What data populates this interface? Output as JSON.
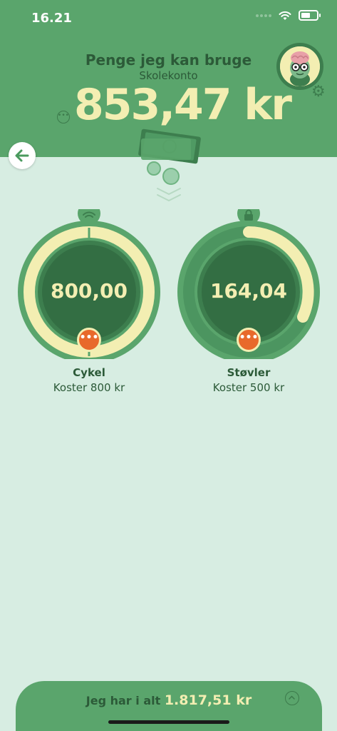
{
  "status_bar": {
    "time": "16.21"
  },
  "header": {
    "title": "Penge jeg kan bruge",
    "subtitle": "Skolekonto",
    "balance": "853,47 kr"
  },
  "goals": [
    {
      "amount": "800,00",
      "name": "Cykel",
      "cost": "Koster 800 kr",
      "top_icon": "wifi-icon",
      "progress": 1.0
    },
    {
      "amount": "164,04",
      "name": "Støvler",
      "cost": "Koster 500 kr",
      "top_icon": "lock-icon",
      "progress": 0.33
    }
  ],
  "footer": {
    "label": "Jeg har i alt",
    "total": "1.817,51 kr"
  },
  "colors": {
    "header_green": "#5aa56c",
    "dark_green": "#3d7e4e",
    "background": "#d7ede2",
    "cream": "#f3eeb2",
    "orange": "#e8692b"
  }
}
